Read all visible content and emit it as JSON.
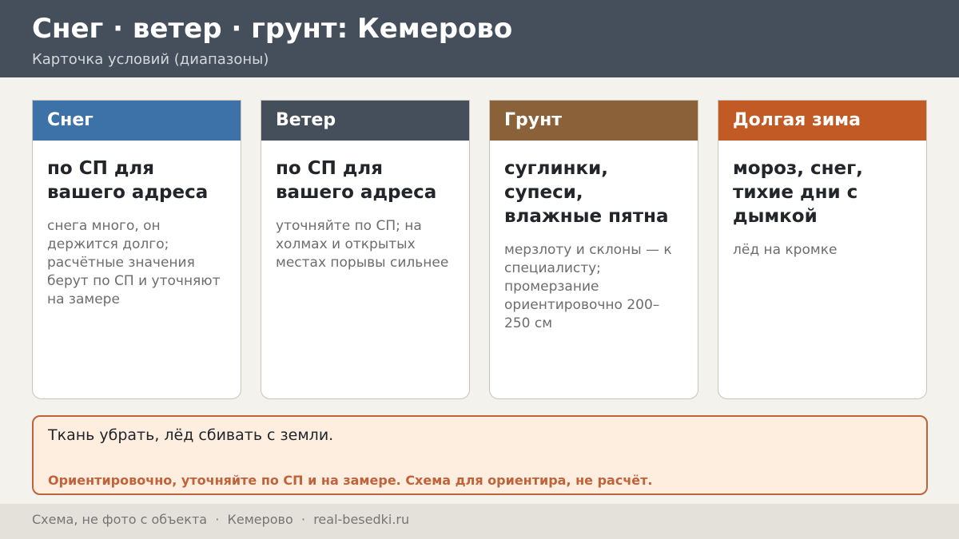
{
  "header": {
    "title": "Снег · ветер · грунт: Кемерово",
    "subtitle": "Карточка условий (диапазоны)"
  },
  "cards": [
    {
      "heading": "Снег",
      "color": "#3c72a8",
      "main": "по СП для вашего адреса",
      "note": "снега много, он держится долго; расчётные значения берут по СП и уточняют на замере"
    },
    {
      "heading": "Ветер",
      "color": "#454f5b",
      "main": "по СП для вашего адреса",
      "note": "уточняйте по СП; на холмах и открытых местах порывы сильнее"
    },
    {
      "heading": "Грунт",
      "color": "#8b613a",
      "main": "суглинки, супеси, влажные пятна",
      "note": "мерзлоту и склоны — к специалисту; промерзание ориентировочно 200–250 см"
    },
    {
      "heading": "Долгая зима",
      "color": "#c25a26",
      "main": "мороз, снег, тихие дни с дымкой",
      "note": "лёд на кромке"
    }
  ],
  "notice": {
    "main": "Ткань убрать, лёд сбивать с земли.",
    "warning": "Ориентировочно, уточняйте по СП и на замере. Схема для ориентира, не расчёт.",
    "warning_color": "#c0623a"
  },
  "footer": {
    "text": "Схема, не фото с объекта  ·  Кемерово  ·  real-besedki.ru"
  }
}
